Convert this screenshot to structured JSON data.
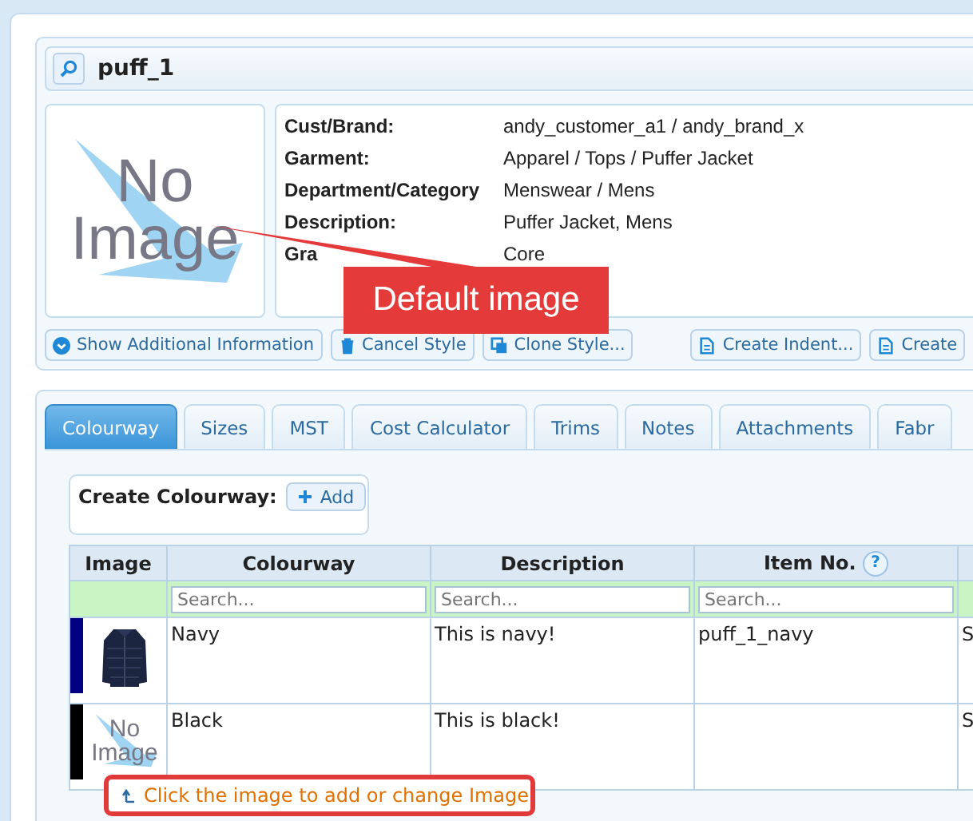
{
  "title": "puff_1",
  "image_box": {
    "text": "No Image"
  },
  "details": [
    {
      "label": "Cust/Brand:",
      "value": "andy_customer_a1 / andy_brand_x"
    },
    {
      "label": "Garment:",
      "value": "Apparel / Tops / Puffer Jacket"
    },
    {
      "label": "Department/Category",
      "value": "Menswear / Mens"
    },
    {
      "label": "Description:",
      "value": "Puffer Jacket, Mens"
    },
    {
      "label": "Gra",
      "value": "Core"
    }
  ],
  "actions": {
    "left": [
      {
        "label": "Show Additional Information"
      },
      {
        "label": "Cancel Style"
      },
      {
        "label": "Clone Style..."
      }
    ],
    "right": [
      {
        "label": "Create Indent..."
      },
      {
        "label": "Create"
      }
    ]
  },
  "callout": "Default image",
  "tabs": [
    {
      "label": "Colourway",
      "selected": true
    },
    {
      "label": "Sizes",
      "selected": false
    },
    {
      "label": "MST",
      "selected": false
    },
    {
      "label": "Cost Calculator",
      "selected": false
    },
    {
      "label": "Trims",
      "selected": false
    },
    {
      "label": "Notes",
      "selected": false
    },
    {
      "label": "Attachments",
      "selected": false
    },
    {
      "label": "Fabr",
      "selected": false
    }
  ],
  "create": {
    "label": "Create Colourway:",
    "button": "Add"
  },
  "table": {
    "columns": [
      {
        "label": "Image"
      },
      {
        "label": "Colourway",
        "placeholder": "Search..."
      },
      {
        "label": "Description",
        "placeholder": "Search..."
      },
      {
        "label": "Item No.",
        "help": "?",
        "placeholder": "Search..."
      }
    ],
    "rows": [
      {
        "color": "#000080",
        "colourway": "Navy",
        "description": "This is navy!",
        "item_no": "puff_1_navy",
        "column_5": "S"
      },
      {
        "color": "#000000",
        "image": {
          "kind": "placeholder",
          "text": "No Image"
        },
        "colourway": "Black",
        "description": "This is black!",
        "column_5": "S"
      }
    ]
  },
  "hint": "Click the image to add or change Image"
}
